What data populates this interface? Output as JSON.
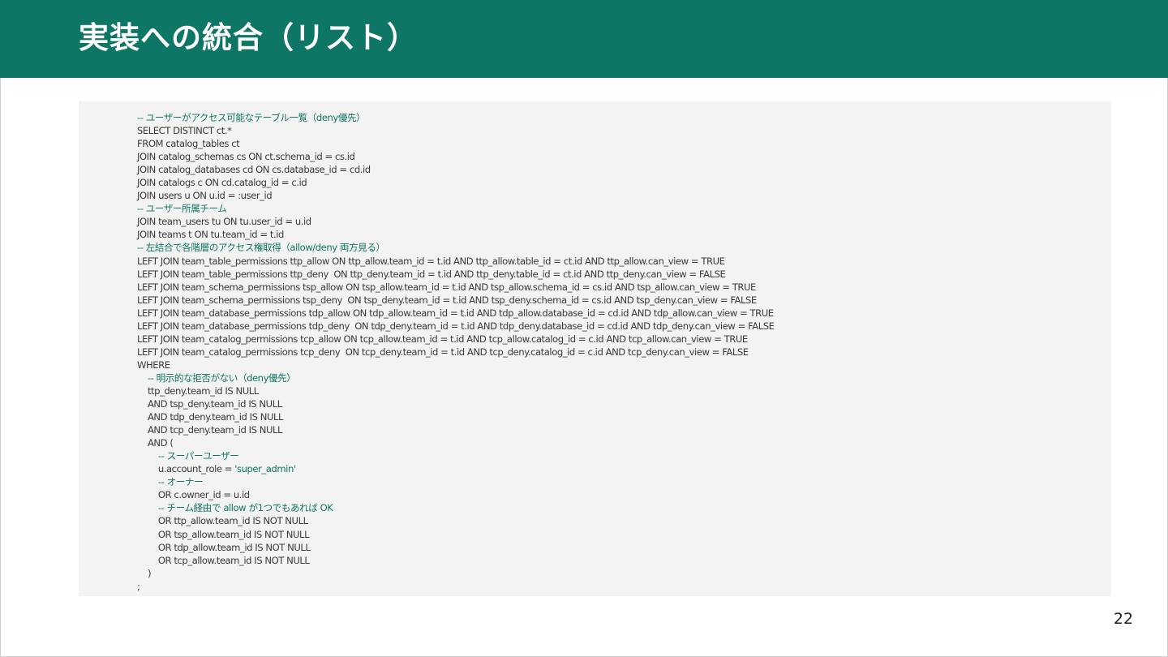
{
  "slide": {
    "title": "実装への統合（リスト）",
    "page_number": "22",
    "colors": {
      "header_background": "#0e7665",
      "code_background": "#f3f3f3",
      "comment_text": "#0e7665",
      "code_text": "#3a3a3a"
    }
  },
  "code": {
    "lines": [
      {
        "text": "-- ユーザーがアクセス可能なテーブル一覧（deny優先）",
        "kind": "comment"
      },
      {
        "text": "SELECT DISTINCT ct.*",
        "kind": "code"
      },
      {
        "text": "FROM catalog_tables ct",
        "kind": "code"
      },
      {
        "text": "JOIN catalog_schemas cs ON ct.schema_id = cs.id",
        "kind": "code"
      },
      {
        "text": "JOIN catalog_databases cd ON cs.database_id = cd.id",
        "kind": "code"
      },
      {
        "text": "JOIN catalogs c ON cd.catalog_id = c.id",
        "kind": "code"
      },
      {
        "text": "JOIN users u ON u.id = :user_id",
        "kind": "code"
      },
      {
        "text": "-- ユーザー所属チーム",
        "kind": "comment"
      },
      {
        "text": "JOIN team_users tu ON tu.user_id = u.id",
        "kind": "code"
      },
      {
        "text": "JOIN teams t ON tu.team_id = t.id",
        "kind": "code"
      },
      {
        "text": "-- 左結合で各階層のアクセス権取得（allow/deny 両方見る）",
        "kind": "comment"
      },
      {
        "text": "LEFT JOIN team_table_permissions ttp_allow ON ttp_allow.team_id = t.id AND ttp_allow.table_id = ct.id AND ttp_allow.can_view = TRUE",
        "kind": "code"
      },
      {
        "text": "LEFT JOIN team_table_permissions ttp_deny  ON ttp_deny.team_id = t.id AND ttp_deny.table_id = ct.id AND ttp_deny.can_view = FALSE",
        "kind": "code"
      },
      {
        "text": "LEFT JOIN team_schema_permissions tsp_allow ON tsp_allow.team_id = t.id AND tsp_allow.schema_id = cs.id AND tsp_allow.can_view = TRUE",
        "kind": "code"
      },
      {
        "text": "LEFT JOIN team_schema_permissions tsp_deny  ON tsp_deny.team_id = t.id AND tsp_deny.schema_id = cs.id AND tsp_deny.can_view = FALSE",
        "kind": "code"
      },
      {
        "text": "LEFT JOIN team_database_permissions tdp_allow ON tdp_allow.team_id = t.id AND tdp_allow.database_id = cd.id AND tdp_allow.can_view = TRUE",
        "kind": "code"
      },
      {
        "text": "LEFT JOIN team_database_permissions tdp_deny  ON tdp_deny.team_id = t.id AND tdp_deny.database_id = cd.id AND tdp_deny.can_view = FALSE",
        "kind": "code"
      },
      {
        "text": "LEFT JOIN team_catalog_permissions tcp_allow ON tcp_allow.team_id = t.id AND tcp_allow.catalog_id = c.id AND tcp_allow.can_view = TRUE",
        "kind": "code"
      },
      {
        "text": "LEFT JOIN team_catalog_permissions tcp_deny  ON tcp_deny.team_id = t.id AND tcp_deny.catalog_id = c.id AND tcp_deny.can_view = FALSE",
        "kind": "code"
      },
      {
        "text": "WHERE",
        "kind": "code"
      },
      {
        "text": "    -- 明示的な拒否がない（deny優先）",
        "kind": "comment"
      },
      {
        "text": "    ttp_deny.team_id IS NULL",
        "kind": "code"
      },
      {
        "text": "    AND tsp_deny.team_id IS NULL",
        "kind": "code"
      },
      {
        "text": "    AND tdp_deny.team_id IS NULL",
        "kind": "code"
      },
      {
        "text": "    AND tcp_deny.team_id IS NULL",
        "kind": "code"
      },
      {
        "text": "    AND (",
        "kind": "code"
      },
      {
        "text": "        -- スーパーユーザー",
        "kind": "comment"
      },
      {
        "text": "        u.account_role = ",
        "kind": "code",
        "string": "'super_admin'"
      },
      {
        "text": "        -- オーナー",
        "kind": "comment"
      },
      {
        "text": "        OR c.owner_id = u.id",
        "kind": "code"
      },
      {
        "text": "        -- チーム経由で allow が1つでもあれば OK",
        "kind": "comment"
      },
      {
        "text": "        OR ttp_allow.team_id IS NOT NULL",
        "kind": "code"
      },
      {
        "text": "        OR tsp_allow.team_id IS NOT NULL",
        "kind": "code"
      },
      {
        "text": "        OR tdp_allow.team_id IS NOT NULL",
        "kind": "code"
      },
      {
        "text": "        OR tcp_allow.team_id IS NOT NULL",
        "kind": "code"
      },
      {
        "text": "    )",
        "kind": "code"
      },
      {
        "text": ";",
        "kind": "code"
      }
    ]
  }
}
